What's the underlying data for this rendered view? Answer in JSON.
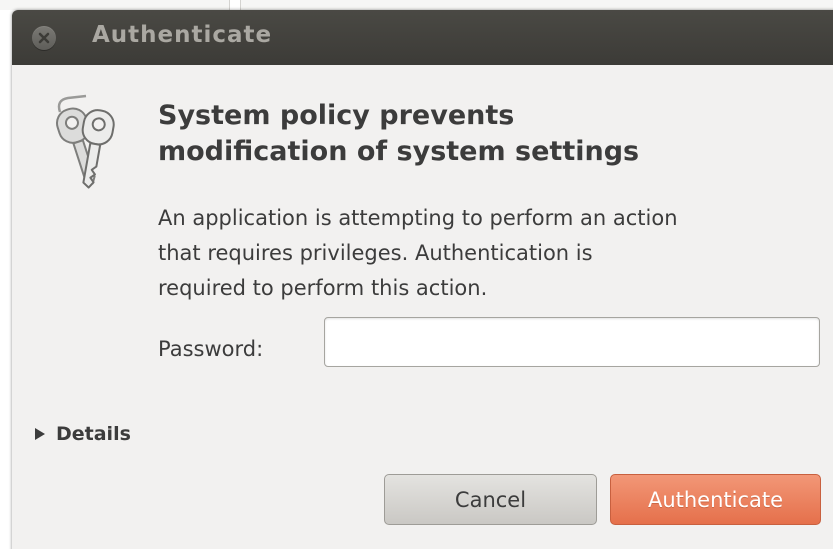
{
  "window": {
    "title": "Authenticate"
  },
  "dialog": {
    "icon": "keys-icon",
    "heading_lines": [
      "System policy prevents",
      "modification of system settings"
    ],
    "message_lines": [
      "An application is attempting to perform an action",
      "that requires privileges. Authentication is",
      "required to perform this action."
    ],
    "password": {
      "label": "Password:",
      "value": "",
      "placeholder": ""
    },
    "details": {
      "label": "Details",
      "expanded": false
    },
    "buttons": {
      "cancel_label": "Cancel",
      "authenticate_label": "Authenticate"
    }
  },
  "colors": {
    "titlebar": "#3c3b37",
    "title_text": "#aaa8a2",
    "dialog_background": "#f2f1f0",
    "accent_button": "#e9805c",
    "text": "#3c3c3c"
  }
}
